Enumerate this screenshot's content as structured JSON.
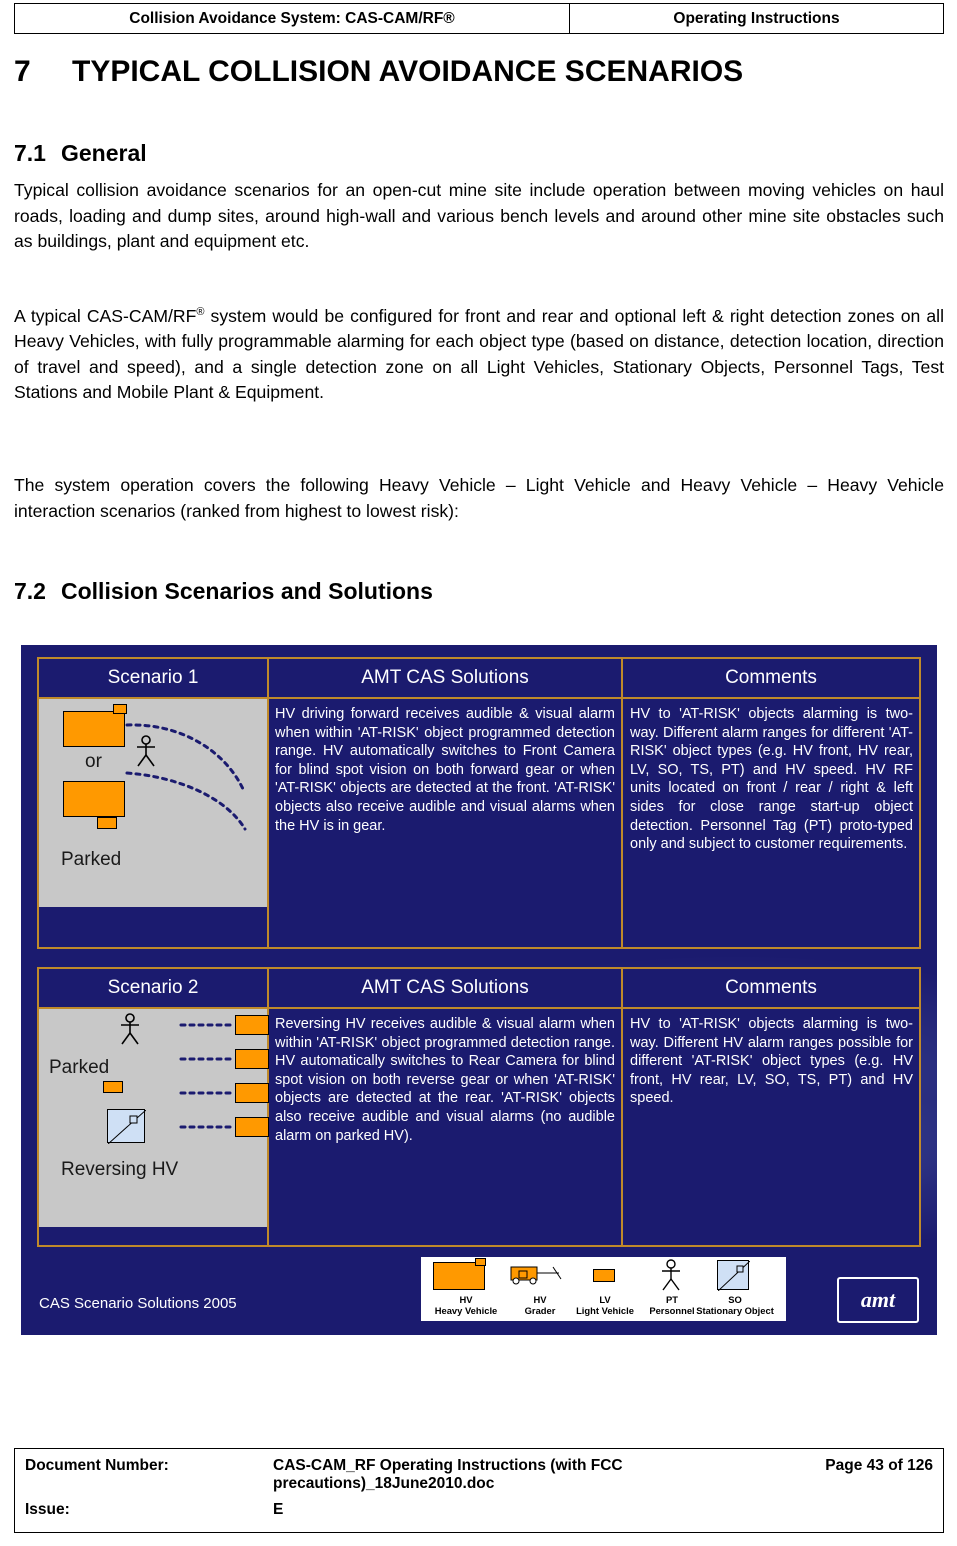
{
  "header": {
    "left": "Collision Avoidance System: CAS-CAM/RF®",
    "right": "Operating Instructions"
  },
  "section7": {
    "number": "7",
    "title": "TYPICAL COLLISION AVOIDANCE SCENARIOS"
  },
  "section71": {
    "number": "7.1",
    "title": "General",
    "para1": "Typical collision avoidance scenarios for an open-cut mine site include operation between moving vehicles on haul roads, loading and dump sites, around high-wall and various bench levels and around other mine site obstacles such as buildings, plant and equipment etc.",
    "para2_a": "A typical CAS-CAM/RF",
    "para2_sup": "®",
    "para2_b": " system would be configured for front and rear and optional left & right detection zones on all Heavy Vehicles, with fully programmable alarming for each object type (based on distance, detection location, direction of travel and speed), and a single detection zone on all Light Vehicles, Stationary Objects, Personnel Tags, Test Stations and Mobile Plant & Equipment.",
    "para3": "The system operation covers the following Heavy Vehicle – Light Vehicle and Heavy Vehicle – Heavy Vehicle interaction scenarios (ranked from highest to lowest risk):"
  },
  "section72": {
    "number": "7.2",
    "title": "Collision Scenarios and Solutions"
  },
  "figure": {
    "caption": "CAS Scenario Solutions 2005",
    "logo_text": "amt",
    "scenario1": {
      "head_a": "Scenario 1",
      "head_b": "AMT CAS Solutions",
      "head_c": "Comments",
      "image_label_or": "or",
      "image_label_parked": "Parked",
      "solutions": "HV driving forward receives audible & visual alarm when within 'AT-RISK' object programmed detection range. HV automatically switches to Front Camera for blind spot vision on both forward gear or when 'AT-RISK' objects are detected at the front. 'AT-RISK' objects also receive audible and visual alarms when the HV is in gear.",
      "comments": "HV to 'AT-RISK' objects alarming is two-way. Different alarm ranges for different 'AT-RISK' object types (e.g. HV front, HV rear, LV, SO, TS, PT) and HV speed. HV RF units located on front / rear / right & left sides for close range start-up object detection. Personnel Tag (PT) proto-typed only and subject to customer requirements."
    },
    "scenario2": {
      "head_a": "Scenario 2",
      "head_b": "AMT CAS Solutions",
      "head_c": "Comments",
      "image_label_parked": "Parked",
      "image_label_reversing": "Reversing HV",
      "solutions": "Reversing HV receives audible & visual alarm when within 'AT-RISK' object programmed detection range. HV automatically switches to Rear Camera for blind spot vision on both reverse gear or when 'AT-RISK' objects are detected at the rear. 'AT-RISK' objects also receive audible and visual alarms (no audible alarm on parked HV).",
      "comments": "HV to 'AT-RISK' objects alarming is two-way. Different HV alarm ranges possible for different 'AT-RISK' object types (e.g. HV front, HV rear, LV, SO, TS, PT) and HV speed."
    },
    "legend": [
      {
        "abbr": "HV",
        "name": "Heavy Vehicle",
        "icon": "heavy-vehicle-icon"
      },
      {
        "abbr": "HV",
        "name": "Grader",
        "icon": "grader-icon"
      },
      {
        "abbr": "LV",
        "name": "Light Vehicle",
        "icon": "light-vehicle-icon"
      },
      {
        "abbr": "PT",
        "name": "Personnel",
        "icon": "personnel-icon"
      },
      {
        "abbr": "SO",
        "name": "Stationary Object",
        "icon": "stationary-object-icon"
      }
    ]
  },
  "footer": {
    "doc_number_label": "Document Number:",
    "doc_number_value_line1": "CAS-CAM_RF Operating Instructions (with FCC",
    "doc_number_value_page": "Page 43 of  126",
    "doc_number_value_line2": "precautions)_18June2010.doc",
    "issue_label": "Issue:",
    "issue_value": "E"
  },
  "colors": {
    "figure_bg": "#1b1b6f",
    "figure_border": "#c08a2a",
    "vehicle_orange": "#ff9900",
    "image_panel": "#c8c8c8"
  }
}
